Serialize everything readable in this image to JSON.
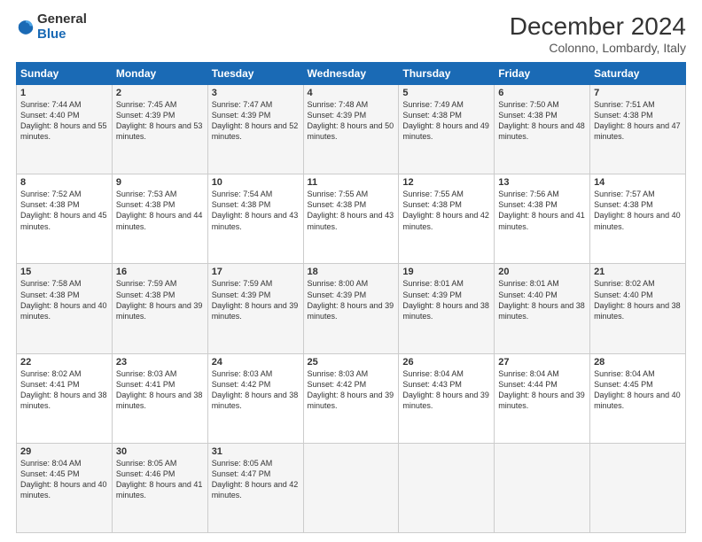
{
  "header": {
    "logo": {
      "general": "General",
      "blue": "Blue"
    },
    "title": "December 2024",
    "subtitle": "Colonno, Lombardy, Italy"
  },
  "calendar": {
    "days_of_week": [
      "Sunday",
      "Monday",
      "Tuesday",
      "Wednesday",
      "Thursday",
      "Friday",
      "Saturday"
    ],
    "weeks": [
      [
        {
          "day": "1",
          "sunrise": "Sunrise: 7:44 AM",
          "sunset": "Sunset: 4:40 PM",
          "daylight": "Daylight: 8 hours and 55 minutes."
        },
        {
          "day": "2",
          "sunrise": "Sunrise: 7:45 AM",
          "sunset": "Sunset: 4:39 PM",
          "daylight": "Daylight: 8 hours and 53 minutes."
        },
        {
          "day": "3",
          "sunrise": "Sunrise: 7:47 AM",
          "sunset": "Sunset: 4:39 PM",
          "daylight": "Daylight: 8 hours and 52 minutes."
        },
        {
          "day": "4",
          "sunrise": "Sunrise: 7:48 AM",
          "sunset": "Sunset: 4:39 PM",
          "daylight": "Daylight: 8 hours and 50 minutes."
        },
        {
          "day": "5",
          "sunrise": "Sunrise: 7:49 AM",
          "sunset": "Sunset: 4:38 PM",
          "daylight": "Daylight: 8 hours and 49 minutes."
        },
        {
          "day": "6",
          "sunrise": "Sunrise: 7:50 AM",
          "sunset": "Sunset: 4:38 PM",
          "daylight": "Daylight: 8 hours and 48 minutes."
        },
        {
          "day": "7",
          "sunrise": "Sunrise: 7:51 AM",
          "sunset": "Sunset: 4:38 PM",
          "daylight": "Daylight: 8 hours and 47 minutes."
        }
      ],
      [
        {
          "day": "8",
          "sunrise": "Sunrise: 7:52 AM",
          "sunset": "Sunset: 4:38 PM",
          "daylight": "Daylight: 8 hours and 45 minutes."
        },
        {
          "day": "9",
          "sunrise": "Sunrise: 7:53 AM",
          "sunset": "Sunset: 4:38 PM",
          "daylight": "Daylight: 8 hours and 44 minutes."
        },
        {
          "day": "10",
          "sunrise": "Sunrise: 7:54 AM",
          "sunset": "Sunset: 4:38 PM",
          "daylight": "Daylight: 8 hours and 43 minutes."
        },
        {
          "day": "11",
          "sunrise": "Sunrise: 7:55 AM",
          "sunset": "Sunset: 4:38 PM",
          "daylight": "Daylight: 8 hours and 43 minutes."
        },
        {
          "day": "12",
          "sunrise": "Sunrise: 7:55 AM",
          "sunset": "Sunset: 4:38 PM",
          "daylight": "Daylight: 8 hours and 42 minutes."
        },
        {
          "day": "13",
          "sunrise": "Sunrise: 7:56 AM",
          "sunset": "Sunset: 4:38 PM",
          "daylight": "Daylight: 8 hours and 41 minutes."
        },
        {
          "day": "14",
          "sunrise": "Sunrise: 7:57 AM",
          "sunset": "Sunset: 4:38 PM",
          "daylight": "Daylight: 8 hours and 40 minutes."
        }
      ],
      [
        {
          "day": "15",
          "sunrise": "Sunrise: 7:58 AM",
          "sunset": "Sunset: 4:38 PM",
          "daylight": "Daylight: 8 hours and 40 minutes."
        },
        {
          "day": "16",
          "sunrise": "Sunrise: 7:59 AM",
          "sunset": "Sunset: 4:38 PM",
          "daylight": "Daylight: 8 hours and 39 minutes."
        },
        {
          "day": "17",
          "sunrise": "Sunrise: 7:59 AM",
          "sunset": "Sunset: 4:39 PM",
          "daylight": "Daylight: 8 hours and 39 minutes."
        },
        {
          "day": "18",
          "sunrise": "Sunrise: 8:00 AM",
          "sunset": "Sunset: 4:39 PM",
          "daylight": "Daylight: 8 hours and 39 minutes."
        },
        {
          "day": "19",
          "sunrise": "Sunrise: 8:01 AM",
          "sunset": "Sunset: 4:39 PM",
          "daylight": "Daylight: 8 hours and 38 minutes."
        },
        {
          "day": "20",
          "sunrise": "Sunrise: 8:01 AM",
          "sunset": "Sunset: 4:40 PM",
          "daylight": "Daylight: 8 hours and 38 minutes."
        },
        {
          "day": "21",
          "sunrise": "Sunrise: 8:02 AM",
          "sunset": "Sunset: 4:40 PM",
          "daylight": "Daylight: 8 hours and 38 minutes."
        }
      ],
      [
        {
          "day": "22",
          "sunrise": "Sunrise: 8:02 AM",
          "sunset": "Sunset: 4:41 PM",
          "daylight": "Daylight: 8 hours and 38 minutes."
        },
        {
          "day": "23",
          "sunrise": "Sunrise: 8:03 AM",
          "sunset": "Sunset: 4:41 PM",
          "daylight": "Daylight: 8 hours and 38 minutes."
        },
        {
          "day": "24",
          "sunrise": "Sunrise: 8:03 AM",
          "sunset": "Sunset: 4:42 PM",
          "daylight": "Daylight: 8 hours and 38 minutes."
        },
        {
          "day": "25",
          "sunrise": "Sunrise: 8:03 AM",
          "sunset": "Sunset: 4:42 PM",
          "daylight": "Daylight: 8 hours and 39 minutes."
        },
        {
          "day": "26",
          "sunrise": "Sunrise: 8:04 AM",
          "sunset": "Sunset: 4:43 PM",
          "daylight": "Daylight: 8 hours and 39 minutes."
        },
        {
          "day": "27",
          "sunrise": "Sunrise: 8:04 AM",
          "sunset": "Sunset: 4:44 PM",
          "daylight": "Daylight: 8 hours and 39 minutes."
        },
        {
          "day": "28",
          "sunrise": "Sunrise: 8:04 AM",
          "sunset": "Sunset: 4:45 PM",
          "daylight": "Daylight: 8 hours and 40 minutes."
        }
      ],
      [
        {
          "day": "29",
          "sunrise": "Sunrise: 8:04 AM",
          "sunset": "Sunset: 4:45 PM",
          "daylight": "Daylight: 8 hours and 40 minutes."
        },
        {
          "day": "30",
          "sunrise": "Sunrise: 8:05 AM",
          "sunset": "Sunset: 4:46 PM",
          "daylight": "Daylight: 8 hours and 41 minutes."
        },
        {
          "day": "31",
          "sunrise": "Sunrise: 8:05 AM",
          "sunset": "Sunset: 4:47 PM",
          "daylight": "Daylight: 8 hours and 42 minutes."
        },
        null,
        null,
        null,
        null
      ]
    ]
  }
}
